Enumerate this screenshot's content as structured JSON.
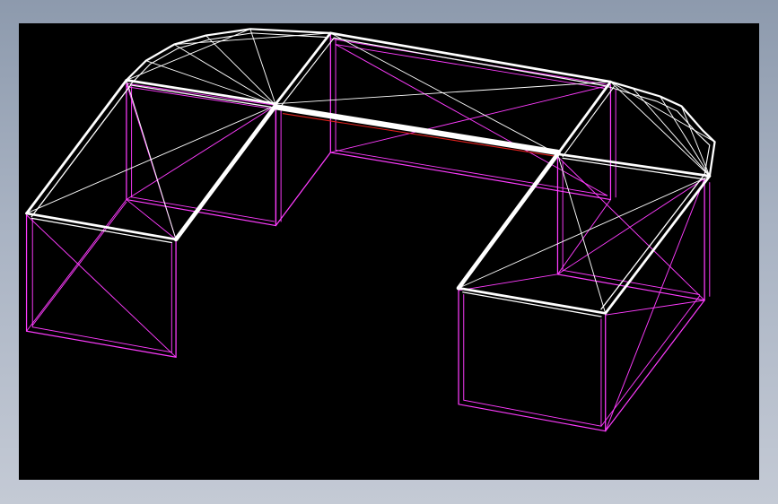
{
  "viewport": {
    "background": "#000000"
  },
  "colors": {
    "frame_top": "#8d9aad",
    "frame_bottom": "#c4cad5",
    "roof_edges": "#ffffff",
    "wall_edges": "#ff3cff",
    "ridge_accent": "#e0201c"
  }
}
